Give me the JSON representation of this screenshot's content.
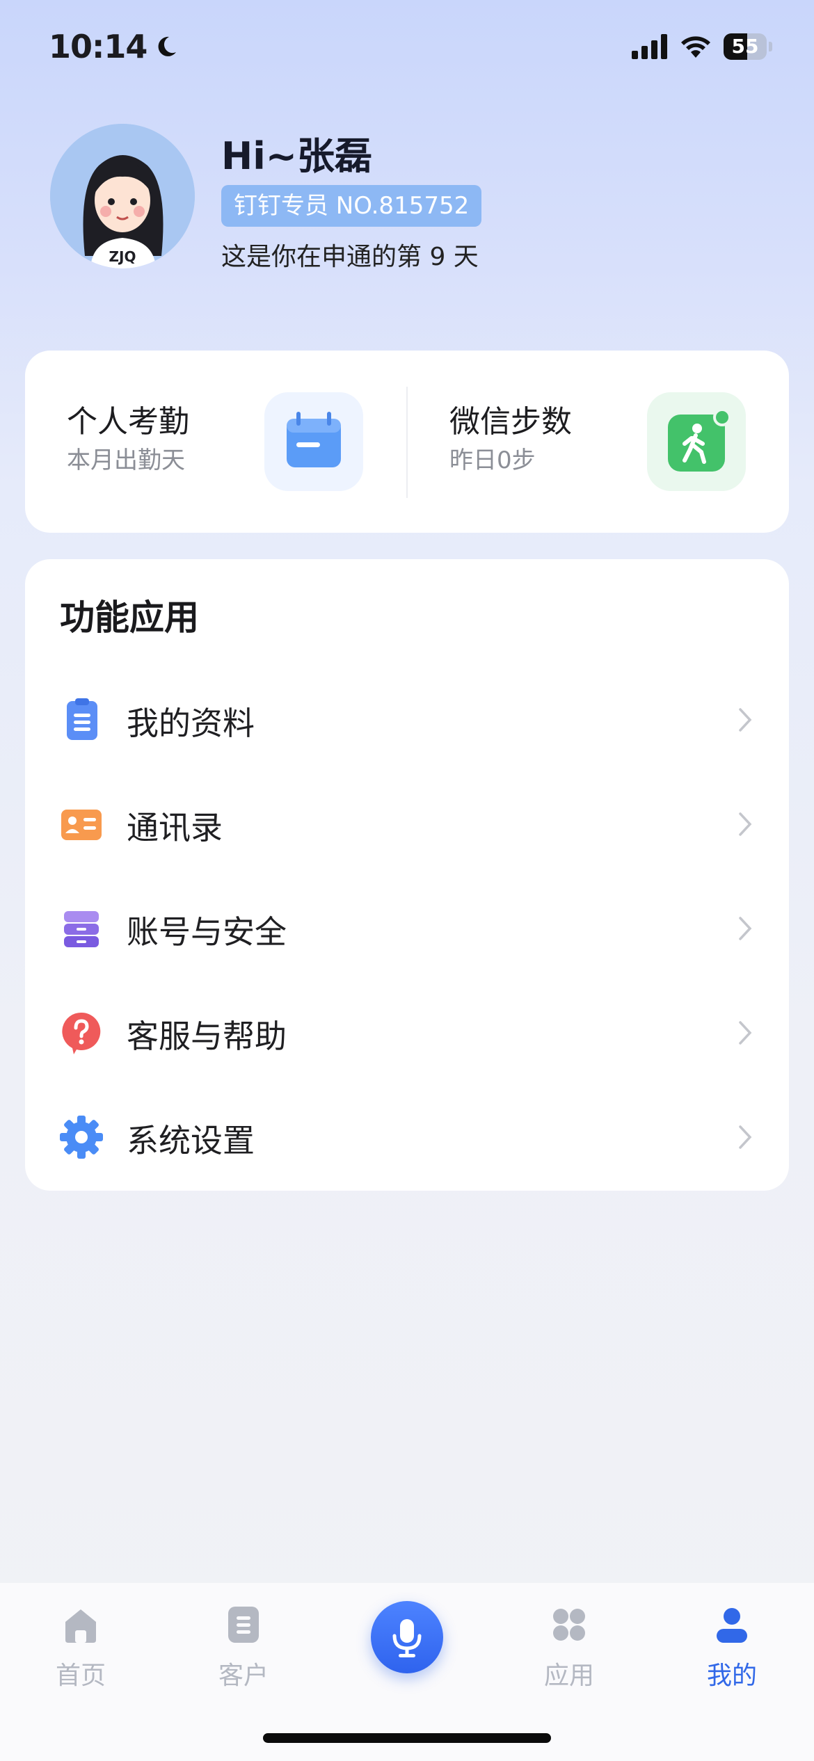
{
  "status_bar": {
    "time": "10:14",
    "battery": "55",
    "battery_level": 0.55
  },
  "profile": {
    "greeting": "Hi~张磊",
    "badge": "钉钉专员 NO.815752",
    "days_text": "这是你在申通的第 9 天"
  },
  "stats": {
    "attendance": {
      "title": "个人考勤",
      "subtitle": "本月出勤天"
    },
    "steps": {
      "title": "微信步数",
      "subtitle": "昨日0步"
    }
  },
  "functions": {
    "title": "功能应用",
    "items": [
      {
        "label": "我的资料",
        "icon": "clipboard-icon"
      },
      {
        "label": "通讯录",
        "icon": "contact-card-icon"
      },
      {
        "label": "账号与安全",
        "icon": "drawer-stack-icon"
      },
      {
        "label": "客服与帮助",
        "icon": "question-icon"
      },
      {
        "label": "系统设置",
        "icon": "gear-icon"
      }
    ]
  },
  "tabbar": {
    "tabs": [
      {
        "label": "首页",
        "icon": "home-icon"
      },
      {
        "label": "客户",
        "icon": "document-icon"
      },
      {
        "label": "",
        "icon": "microphone-icon"
      },
      {
        "label": "应用",
        "icon": "apps-grid-icon"
      },
      {
        "label": "我的",
        "icon": "user-icon"
      }
    ],
    "active": "我的",
    "active_color": "#3168e8",
    "inactive_color": "#b4b8c2"
  }
}
